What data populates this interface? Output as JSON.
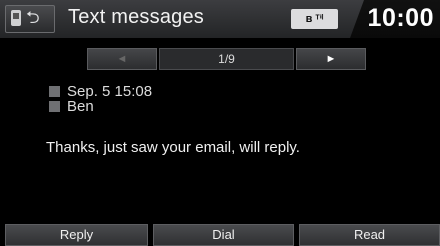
{
  "header": {
    "title": "Text messages",
    "status_indicator": "ʙʇ░ı",
    "clock": "10:00",
    "phone_icon": "phone-icon",
    "back_icon": "back-icon"
  },
  "nav": {
    "prev_label": "◄",
    "next_label": "►",
    "page": "1/9"
  },
  "message": {
    "date": "Sep. 5 15:08",
    "sender": "Ben",
    "body": "Thanks, just saw your email, will reply."
  },
  "footer": {
    "reply_label": "Reply",
    "dial_label": "Dial",
    "read_label": "Read"
  }
}
